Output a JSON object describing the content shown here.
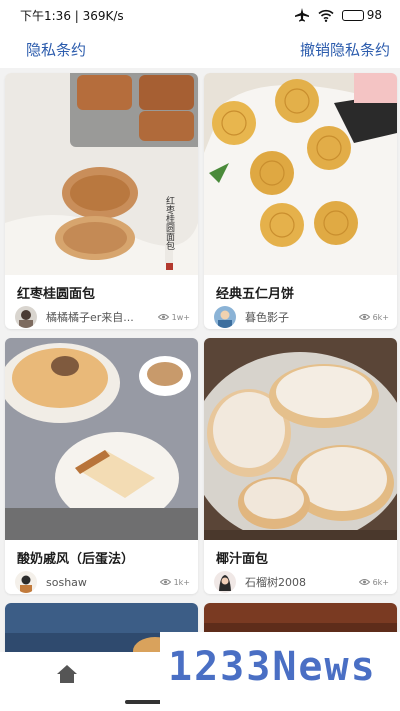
{
  "status_bar": {
    "time_speed": "下午1:36 | 369K/s",
    "battery": "98",
    "battery_level": 0.98
  },
  "header": {
    "privacy_link": "隐私条约",
    "revoke_link": "撤销隐私条约"
  },
  "cards": [
    {
      "title": "红枣桂圆面包",
      "author": "橘橘橘子er来自...",
      "views": "1w+"
    },
    {
      "title": "经典五仁月饼",
      "author": "暮色影子",
      "views": "6k+"
    },
    {
      "title": "酸奶戚风（后蛋法）",
      "author": "soshaw",
      "views": "1k+"
    },
    {
      "title": "椰汁面包",
      "author": "石榴树2008",
      "views": "6k+"
    }
  ],
  "nav": {
    "home_icon": "home-icon"
  },
  "watermark": {
    "text": "1233News"
  },
  "colors": {
    "link": "#2c5cad",
    "watermark": "#4a6fc4",
    "grid_bg": "#f2f2f2"
  }
}
